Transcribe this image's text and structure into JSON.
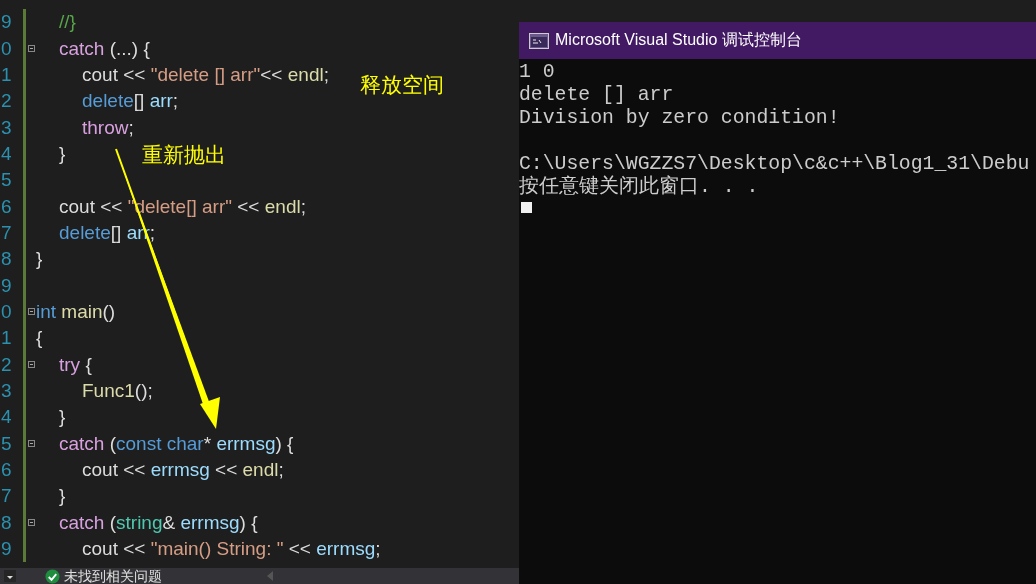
{
  "editor": {
    "lines": [
      {
        "children": [
          {
            "number": "9",
            "foldable": false,
            "tokens": [
              {
                "kind": "comment",
                "text": "//}"
              }
            ]
          },
          {
            "number": "0",
            "foldable": true,
            "tokens": [
              {
                "kind": "keyword",
                "text": "catch"
              },
              {
                "kind": "plain",
                "text": " (...) {"
              }
            ],
            "children": [
              {
                "number": "1",
                "foldable": false,
                "tokens": [
                  {
                    "kind": "plain",
                    "text": "cout << "
                  },
                  {
                    "kind": "string",
                    "text": "\"delete [] arr\""
                  },
                  {
                    "kind": "plain",
                    "text": "<< "
                  },
                  {
                    "kind": "func",
                    "text": "endl"
                  },
                  {
                    "kind": "plain",
                    "text": ";"
                  }
                ]
              },
              {
                "number": "2",
                "foldable": false,
                "tokens": [
                  {
                    "kind": "type",
                    "text": "delete"
                  },
                  {
                    "kind": "plain",
                    "text": "[] "
                  },
                  {
                    "kind": "var",
                    "text": "arr"
                  },
                  {
                    "kind": "plain",
                    "text": ";"
                  }
                ]
              },
              {
                "number": "3",
                "foldable": false,
                "tokens": [
                  {
                    "kind": "keyword",
                    "text": "throw"
                  },
                  {
                    "kind": "plain",
                    "text": ";"
                  }
                ]
              }
            ]
          },
          {
            "number": "4",
            "foldable": false,
            "tokens": [
              {
                "kind": "plain",
                "text": "}"
              }
            ]
          },
          {
            "number": "5",
            "foldable": false
          },
          {
            "number": "6",
            "foldable": false,
            "tokens": [
              {
                "kind": "plain",
                "text": "cout << "
              },
              {
                "kind": "string",
                "text": "\"delete[] arr\""
              },
              {
                "kind": "plain",
                "text": " << "
              },
              {
                "kind": "func",
                "text": "endl"
              },
              {
                "kind": "plain",
                "text": ";"
              }
            ]
          },
          {
            "number": "7",
            "foldable": false,
            "tokens": [
              {
                "kind": "type",
                "text": "delete"
              },
              {
                "kind": "plain",
                "text": "[] "
              },
              {
                "kind": "var",
                "text": "arr"
              },
              {
                "kind": "plain",
                "text": ";"
              }
            ]
          }
        ]
      },
      {
        "number": "8",
        "foldable": false,
        "tokens": [
          {
            "kind": "plain",
            "text": "}"
          }
        ]
      },
      {
        "number": "9",
        "foldable": false
      },
      {
        "number": "0",
        "foldable": true,
        "tokens": [
          {
            "kind": "type",
            "text": "int "
          },
          {
            "kind": "func",
            "text": "main"
          },
          {
            "kind": "plain",
            "text": "()"
          }
        ]
      },
      {
        "number": "1",
        "foldable": false,
        "tokens": [
          {
            "kind": "plain",
            "text": "{"
          }
        ],
        "children": [
          {
            "number": "2",
            "foldable": true,
            "tokens": [
              {
                "kind": "keyword",
                "text": "try"
              },
              {
                "kind": "plain",
                "text": " {"
              }
            ],
            "children": [
              {
                "number": "3",
                "foldable": false,
                "tokens": [
                  {
                    "kind": "func",
                    "text": "Func1"
                  },
                  {
                    "kind": "plain",
                    "text": "();"
                  }
                ]
              }
            ]
          },
          {
            "number": "4",
            "foldable": false,
            "tokens": [
              {
                "kind": "plain",
                "text": "}"
              }
            ]
          },
          {
            "number": "5",
            "foldable": true,
            "tokens": [
              {
                "kind": "keyword",
                "text": "catch"
              },
              {
                "kind": "plain",
                "text": " ("
              },
              {
                "kind": "type",
                "text": "const char"
              },
              {
                "kind": "plain",
                "text": "* "
              },
              {
                "kind": "var",
                "text": "errmsg"
              },
              {
                "kind": "plain",
                "text": ") {"
              }
            ],
            "children": [
              {
                "number": "6",
                "foldable": false,
                "tokens": [
                  {
                    "kind": "plain",
                    "text": "cout << "
                  },
                  {
                    "kind": "var",
                    "text": "errmsg"
                  },
                  {
                    "kind": "plain",
                    "text": " << "
                  },
                  {
                    "kind": "func",
                    "text": "endl"
                  },
                  {
                    "kind": "plain",
                    "text": ";"
                  }
                ]
              }
            ]
          },
          {
            "number": "7",
            "foldable": false,
            "tokens": [
              {
                "kind": "plain",
                "text": "}"
              }
            ]
          },
          {
            "number": "8",
            "foldable": true,
            "tokens": [
              {
                "kind": "keyword",
                "text": "catch"
              },
              {
                "kind": "plain",
                "text": " ("
              },
              {
                "kind": "class",
                "text": "string"
              },
              {
                "kind": "plain",
                "text": "& "
              },
              {
                "kind": "var",
                "text": "errmsg"
              },
              {
                "kind": "plain",
                "text": ") {"
              }
            ],
            "children": [
              {
                "number": "9",
                "foldable": false,
                "tokens": [
                  {
                    "kind": "plain",
                    "text": "cout << "
                  },
                  {
                    "kind": "string",
                    "text": "\"main() String: \""
                  },
                  {
                    "kind": "plain",
                    "text": " << "
                  },
                  {
                    "kind": "var",
                    "text": "errmsg"
                  },
                  {
                    "kind": "plain",
                    "text": ";"
                  }
                ]
              }
            ]
          }
        ]
      }
    ]
  },
  "annotations": [
    {
      "kind": "label",
      "text": "释放空间"
    },
    {
      "kind": "label",
      "text": "重新抛出"
    },
    {
      "kind": "arrow"
    }
  ],
  "status_bar": {
    "message": "未找到相关问题"
  },
  "console": {
    "title": "Microsoft Visual Studio 调试控制台",
    "lines": [
      "1 0",
      "delete [] arr",
      "Division by zero condition!"
    ],
    "after_blank": [
      "C:\\Users\\WGZZS7\\Desktop\\c&c++\\Blog1_31\\Debu",
      "按任意键关闭此窗口. . ."
    ],
    "cursor_visible": true
  }
}
